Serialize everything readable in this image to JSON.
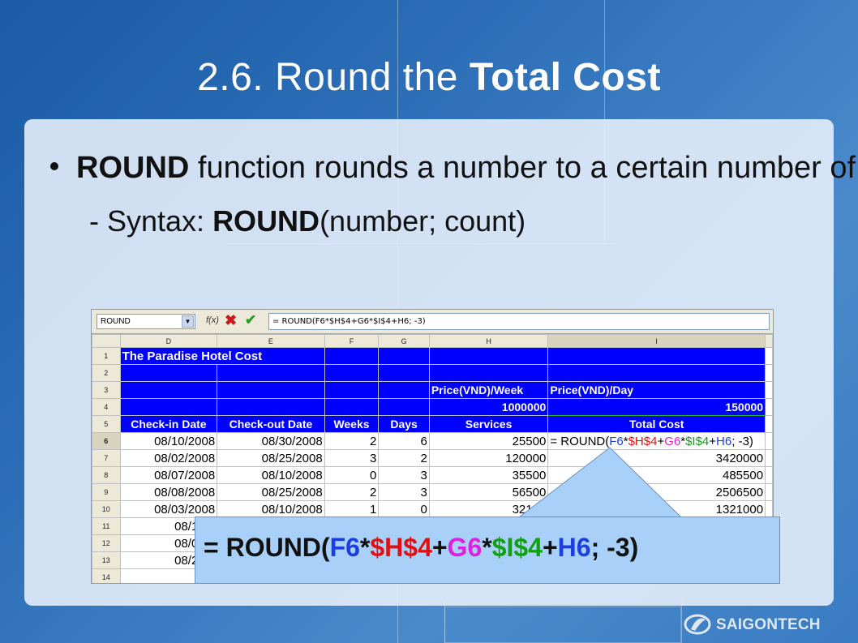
{
  "slide": {
    "title_prefix": "2.6. Round the ",
    "title_bold": "Total Cost",
    "bullet_bold": "ROUND",
    "bullet_rest": " function rounds a number to a certain number of decimal places.",
    "syntax_prefix": "- Syntax: ",
    "syntax_bold": "ROUND",
    "syntax_rest": "(number; count)",
    "brand": "SAIGONTECH"
  },
  "spreadsheet": {
    "name_box": "ROUND",
    "fx_label": "f(x)",
    "formula": "= ROUND(F6*$H$4+G6*$I$4+H6; -3)",
    "columns": [
      "D",
      "E",
      "F",
      "G",
      "H",
      "I"
    ],
    "row_numbers": [
      "1",
      "2",
      "3",
      "4",
      "5",
      "6",
      "7",
      "8",
      "9",
      "10",
      "11",
      "12",
      "13",
      "14"
    ],
    "sheet_title": "The Paradise Hotel Cost",
    "price_week_label": "Price(VND)/Week",
    "price_day_label": "Price(VND)/Day",
    "price_week_value": "1000000",
    "price_day_value": "150000",
    "headers": [
      "Check-in Date",
      "Check-out Date",
      "Weeks",
      "Days",
      "Services",
      "Total Cost"
    ],
    "rows": [
      {
        "checkin": "08/10/2008",
        "checkout": "08/30/2008",
        "weeks": "2",
        "days": "6",
        "services": "25500",
        "total": "= ROUND(F6*$H$4+G6*$I$4+H6; -3)"
      },
      {
        "checkin": "08/02/2008",
        "checkout": "08/25/2008",
        "weeks": "3",
        "days": "2",
        "services": "120000",
        "total": "3420000"
      },
      {
        "checkin": "08/07/2008",
        "checkout": "08/10/2008",
        "weeks": "0",
        "days": "3",
        "services": "35500",
        "total": "485500"
      },
      {
        "checkin": "08/08/2008",
        "checkout": "08/25/2008",
        "weeks": "2",
        "days": "3",
        "services": "56500",
        "total": "2506500"
      },
      {
        "checkin": "08/03/2008",
        "checkout": "08/10/2008",
        "weeks": "1",
        "days": "0",
        "services": "32100",
        "total": "1321000"
      },
      {
        "checkin": "08/19/2",
        "checkout": "",
        "weeks": "",
        "days": "",
        "services": "",
        "total": ""
      },
      {
        "checkin": "08/01/2",
        "checkout": "",
        "weeks": "",
        "days": "",
        "services": "",
        "total": ""
      },
      {
        "checkin": "08/26/2",
        "checkout": "",
        "weeks": "",
        "days": "",
        "services": "",
        "total": ""
      }
    ]
  },
  "callout": {
    "eq": "= ROUND(",
    "f6": "F6",
    "star1": "*",
    "h4": "$H$4",
    "plus1": "+",
    "g6": "G6",
    "star2": "*",
    "i4": "$I$4",
    "plus2": "+",
    "h6": "H6",
    "tail": "; -3)"
  },
  "colors": {
    "sheet_blue": "#0000ff",
    "callout_bg": "#a8d0f8",
    "ref_blue": "#1a3ee0",
    "ref_red": "#e01010",
    "ref_magenta": "#e020e0",
    "ref_green": "#10a010"
  }
}
